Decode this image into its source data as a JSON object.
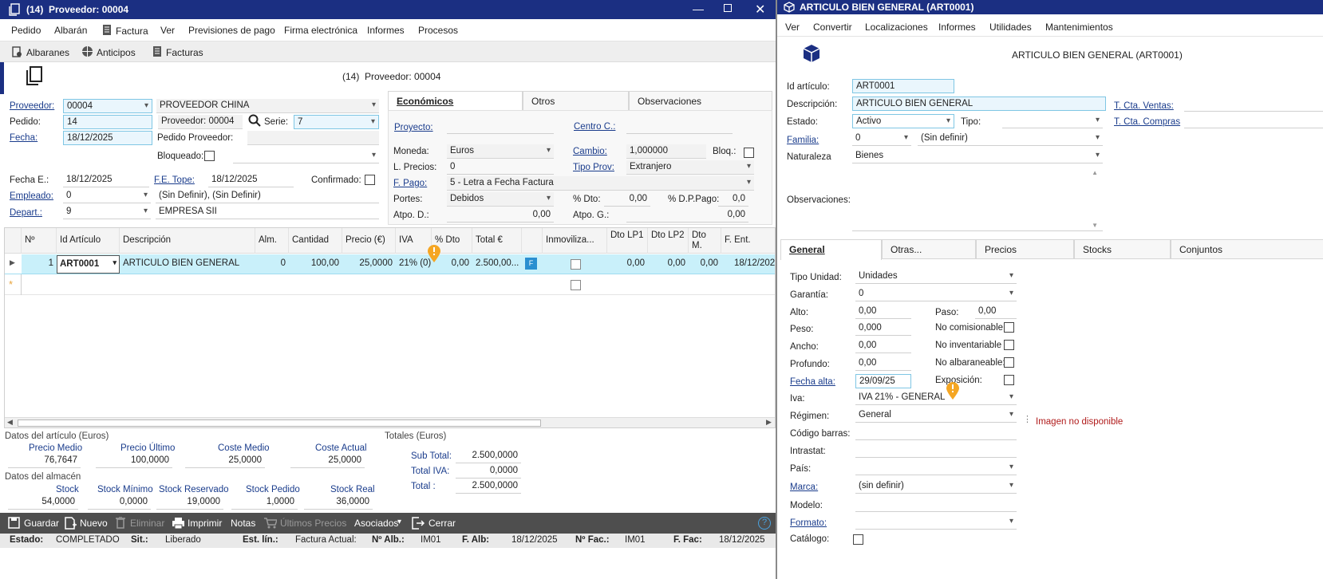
{
  "left": {
    "title": "(14)  Proveedor: 00004",
    "menu": [
      "Pedido",
      "Albarán",
      "Factura",
      "Ver",
      "Previsiones de pago",
      "Firma electrónica",
      "Informes",
      "Procesos"
    ],
    "subtoolbar": [
      "Albaranes",
      "Anticipos",
      "Facturas"
    ],
    "header_text": "(14)  Proveedor: 00004",
    "form": {
      "proveedor_label": "Proveedor:",
      "proveedor_value": "00004",
      "proveedor_name": "PROVEEDOR CHINA",
      "pedido_label": "Pedido:",
      "pedido_value": "14",
      "proveedor_code_text": "Proveedor: 00004",
      "serie_label": "Serie:",
      "serie_value": "7",
      "fecha_label": "Fecha:",
      "fecha_value": "18/12/2025",
      "pedido_proveedor_label": "Pedido Proveedor:",
      "bloqueado_label": "Bloqueado:",
      "fecha_e_label": "Fecha E.:",
      "fecha_e_value": "18/12/2025",
      "fe_tope_label": "F.E. Tope:",
      "fe_tope_value": "18/12/2025",
      "confirmado_label": "Confirmado:",
      "empleado_label": "Empleado:",
      "empleado_value": "0",
      "empleado_name": "(Sin Definir), (Sin Definir)",
      "depart_label": "Depart.:",
      "depart_value": "9",
      "depart_name": "EMPRESA SII"
    },
    "tabs": [
      "Económicos",
      "Otros",
      "Observaciones"
    ],
    "eco": {
      "proyecto_label": "Proyecto:",
      "centro_label": "Centro C.:",
      "moneda_label": "Moneda:",
      "moneda_value": "Euros",
      "cambio_label": "Cambio:",
      "cambio_value": "1,000000",
      "bloq_label": "Bloq.:",
      "lprecios_label": "L. Precios:",
      "lprecios_value": "0",
      "tipoprov_label": "Tipo Prov:",
      "tipoprov_value": "Extranjero",
      "fpago_label": "F. Pago:",
      "fpago_value": "5 - Letra a Fecha Factura",
      "portes_label": "Portes:",
      "portes_value": "Debidos",
      "dto_label": "% Dto:",
      "dto_value": "0,00",
      "dpp_label": "% D.P.Pago:",
      "dpp_value": "0,0",
      "atpod_label": "Atpo. D.:",
      "atpod_value": "0,00",
      "atpog_label": "Atpo. G.:",
      "atpog_value": "0,00"
    },
    "grid": {
      "headers": [
        "Nº",
        "Id Artículo",
        "Descripción",
        "Alm.",
        "Cantidad",
        "Precio (€)",
        "IVA",
        "% Dto",
        "Total €",
        "",
        "Inmoviliza...",
        "Dto LP1",
        "Dto LP2",
        "Dto M.",
        "F. Ent."
      ],
      "row": {
        "n": "1",
        "id": "ART0001",
        "desc": "ARTICULO BIEN GENERAL",
        "alm": "0",
        "cantidad": "100,00",
        "precio": "25,0000",
        "iva": "21% (0)",
        "dto": "0,00",
        "total": "2.500,00...",
        "flag": "F",
        "lp1": "0,00",
        "lp2": "0,00",
        "dtom": "0,00",
        "fent": "18/12/202"
      }
    },
    "datos_articulo": {
      "title": "Datos del artículo (Euros)",
      "items": [
        {
          "label": "Precio Medio",
          "value": "76,7647"
        },
        {
          "label": "Precio Último",
          "value": "100,0000"
        },
        {
          "label": "Coste Medio",
          "value": "25,0000"
        },
        {
          "label": "Coste Actual",
          "value": "25,0000"
        }
      ]
    },
    "datos_almacen": {
      "title": "Datos del almacén",
      "items": [
        {
          "label": "Stock",
          "value": "54,0000"
        },
        {
          "label": "Stock Mínimo",
          "value": "0,0000"
        },
        {
          "label": "Stock Reservado",
          "value": "19,0000"
        },
        {
          "label": "Stock Pedido",
          "value": "1,0000"
        },
        {
          "label": "Stock Real",
          "value": "36,0000"
        }
      ]
    },
    "totales": {
      "title": "Totales (Euros)",
      "items": [
        {
          "label": "Sub Total:",
          "value": "2.500,0000"
        },
        {
          "label": "Total IVA:",
          "value": "0,0000"
        },
        {
          "label": "Total :",
          "value": "2.500,0000"
        }
      ]
    },
    "toolbar": [
      "Guardar",
      "Nuevo",
      "Eliminar",
      "Imprimir",
      "Notas",
      "Últimos Precios",
      "Asociados",
      "Cerrar"
    ],
    "status": {
      "estado_label": "Estado:",
      "estado_value": "COMPLETADO",
      "sit_label": "Sit.:",
      "sit_value": "Liberado",
      "estlin_label": "Est. lín.:",
      "estlin_value": "Factura Actual:",
      "nalb_label": "Nº Alb.:",
      "nalb_value": "IM01",
      "falb_label": "F. Alb:",
      "falb_value": "18/12/2025",
      "nfac_label": "Nº Fac.:",
      "nfac_value": "IM01",
      "ffac_label": "F. Fac:",
      "ffac_value": "18/12/2025"
    }
  },
  "right": {
    "title": "ARTICULO BIEN GENERAL (ART0001)",
    "menu": [
      "Ver",
      "Convertir",
      "Localizaciones",
      "Informes",
      "Utilidades",
      "Mantenimientos"
    ],
    "header_text": "ARTICULO BIEN GENERAL (ART0001)",
    "form": {
      "id_label": "Id artículo:",
      "id_value": "ART0001",
      "desc_label": "Descripción:",
      "desc_value": "ARTICULO BIEN GENERAL",
      "ctaventas_label": "T. Cta. Ventas:",
      "estado_label": "Estado:",
      "estado_value": "Activo",
      "tipo_label": "Tipo:",
      "ctacompras_label": "T. Cta. Compras",
      "familia_label": "Familia:",
      "familia_value": "0",
      "familia_name": "(Sin definir)",
      "naturaleza_label": "Naturaleza",
      "naturaleza_value": "Bienes",
      "obs_label": "Observaciones:"
    },
    "tabs": [
      "General",
      "Otras...",
      "Precios",
      "Stocks",
      "Conjuntos"
    ],
    "general": {
      "tipounidad_label": "Tipo Unidad:",
      "tipounidad_value": "Unidades",
      "garantia_label": "Garantía:",
      "garantia_value": "0",
      "alto_label": "Alto:",
      "alto_value": "0,00",
      "paso_label": "Paso:",
      "paso_value": "0,00",
      "peso_label": "Peso:",
      "peso_value": "0,000",
      "nocom_label": "No comisionable",
      "ancho_label": "Ancho:",
      "ancho_value": "0,00",
      "noinv_label": "No inventariable",
      "profundo_label": "Profundo:",
      "profundo_value": "0,00",
      "noalb_label": "No albaraneable:",
      "fechaalta_label": "Fecha alta:",
      "fechaalta_value": "29/09/25",
      "expo_label": "Exposición:",
      "iva_label": "Iva:",
      "iva_value": "IVA 21% - GENERAL",
      "regimen_label": "Régimen:",
      "regimen_value": "General",
      "imagen_text": "Imagen no disponible",
      "barras_label": "Código barras:",
      "intrastat_label": "Intrastat:",
      "pais_label": "País:",
      "marca_label": "Marca:",
      "marca_value": "(sin definir)",
      "modelo_label": "Modelo:",
      "formato_label": "Formato:",
      "catalogo_label": "Catálogo:"
    }
  }
}
